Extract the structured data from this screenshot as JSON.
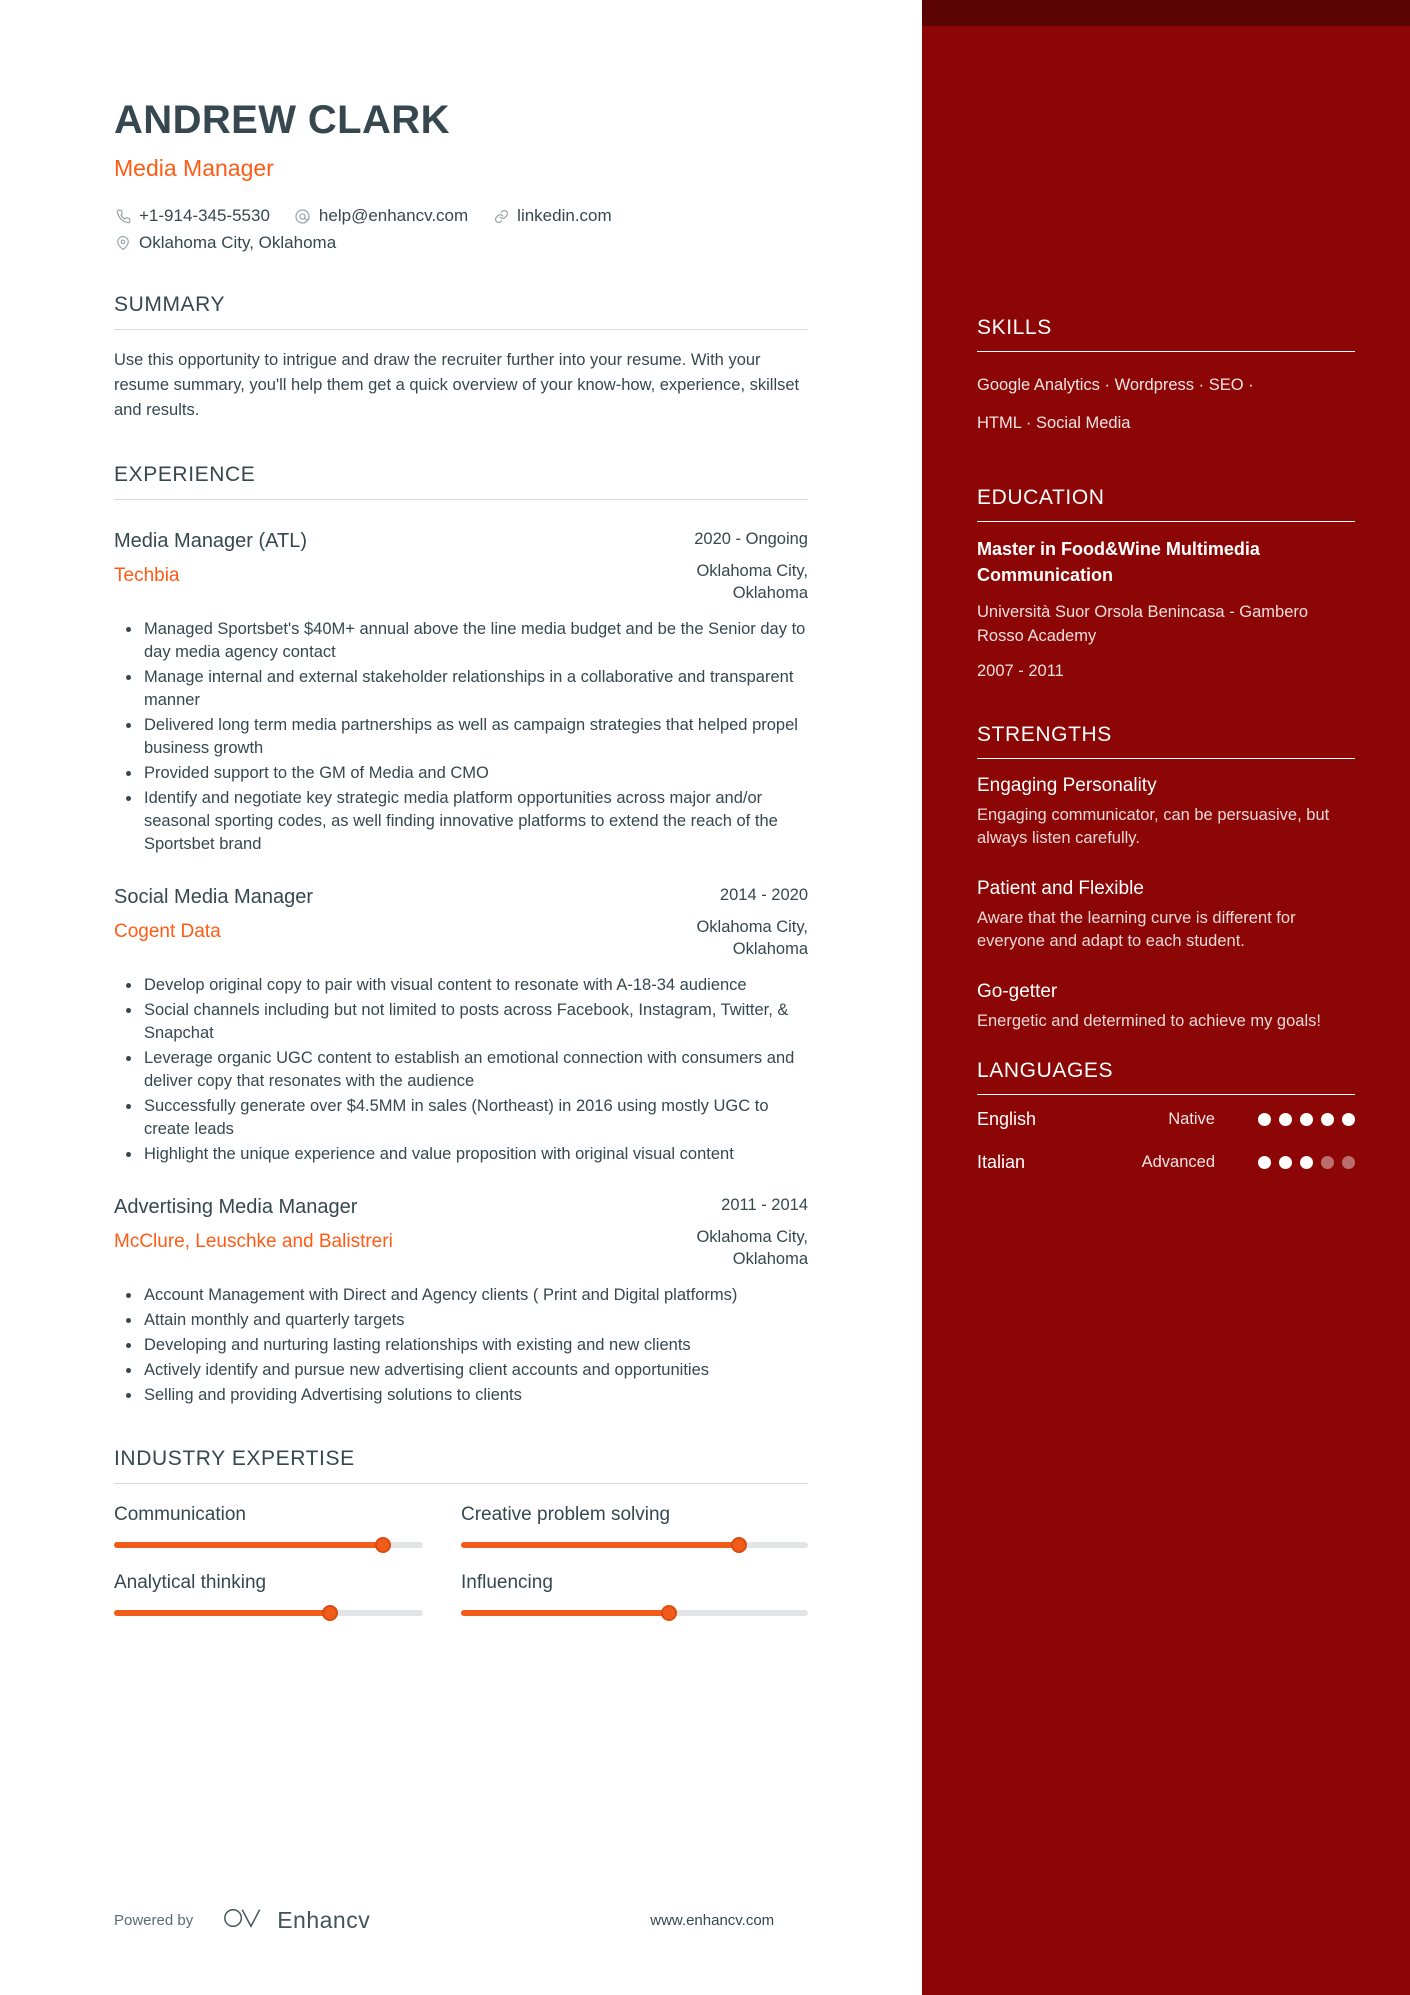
{
  "colors": {
    "accent": "#ff5b14",
    "sidebar_bg": "#8c0606",
    "sidebar_cap": "#5c0303",
    "text": "#37474f"
  },
  "header": {
    "name": "ANDREW CLARK",
    "title": "Media Manager",
    "contacts": [
      {
        "icon": "phone-icon",
        "value": "+1-914-345-5530"
      },
      {
        "icon": "email-icon",
        "value": "help@enhancv.com"
      },
      {
        "icon": "link-icon",
        "value": "linkedin.com"
      }
    ],
    "location": {
      "icon": "location-pin-icon",
      "value": "Oklahoma City, Oklahoma"
    }
  },
  "summary": {
    "heading": "SUMMARY",
    "text": "Use this opportunity to intrigue and draw the recruiter further into your resume. With your resume summary, you'll help them get a quick overview of your know-how, experience, skillset and results."
  },
  "experience": {
    "heading": "EXPERIENCE",
    "entries": [
      {
        "role": "Media Manager (ATL)",
        "company": "Techbia",
        "dates": "2020 - Ongoing",
        "location": "Oklahoma City, Oklahoma",
        "bullets": [
          "Managed Sportsbet's $40M+ annual above the line media budget and be the Senior day to day media agency contact",
          "Manage internal and external stakeholder relationships in a collaborative and transparent manner",
          "Delivered long term media partnerships as well as campaign strategies that helped propel business growth",
          "Provided support to the GM of Media and CMO",
          "Identify and negotiate key strategic media platform opportunities across major and/or seasonal sporting codes, as well finding innovative platforms to extend the reach of the Sportsbet brand"
        ]
      },
      {
        "role": "Social Media Manager",
        "company": "Cogent Data",
        "dates": "2014 - 2020",
        "location": "Oklahoma City, Oklahoma",
        "bullets": [
          "Develop original copy to pair with visual content to resonate with A-18-34 audience",
          "Social channels including but not limited to posts across Facebook, Instagram, Twitter, & Snapchat",
          "Leverage organic UGC content to establish an emotional connection with consumers and deliver copy that resonates with the audience",
          "Successfully generate over $4.5MM in sales (Northeast) in 2016 using mostly UGC to create leads",
          "Highlight the unique experience and value proposition with original visual content"
        ]
      },
      {
        "role": "Advertising Media Manager",
        "company": "McClure, Leuschke and Balistreri",
        "dates": "2011 - 2014",
        "location": "Oklahoma City, Oklahoma",
        "bullets": [
          "Account Management with Direct and Agency clients ( Print and Digital platforms)",
          "Attain monthly and quarterly targets",
          "Developing and nurturing lasting relationships with existing and new clients",
          "Actively identify and pursue new advertising client accounts and opportunities",
          "Selling and providing Advertising solutions to clients"
        ]
      }
    ]
  },
  "industry_expertise": {
    "heading": "INDUSTRY EXPERTISE",
    "items": [
      {
        "label": "Communication",
        "percent": 87
      },
      {
        "label": "Creative problem solving",
        "percent": 80
      },
      {
        "label": "Analytical thinking",
        "percent": 70
      },
      {
        "label": "Influencing",
        "percent": 60
      }
    ]
  },
  "sidebar": {
    "skills": {
      "heading": "SKILLS",
      "lines": [
        "Google Analytics · Wordpress · SEO ·",
        "HTML · Social Media"
      ]
    },
    "education": {
      "heading": "EDUCATION",
      "degree": "Master in Food&Wine Multimedia Communication",
      "school": "Università Suor Orsola Benincasa - Gambero Rosso Academy",
      "dates": "2007 - 2011"
    },
    "strengths": {
      "heading": "STRENGTHS",
      "items": [
        {
          "title": "Engaging Personality",
          "desc": "Engaging communicator, can be persuasive, but always listen carefully."
        },
        {
          "title": "Patient and Flexible",
          "desc": "Aware that the learning curve is different for everyone and adapt to each student."
        },
        {
          "title": "Go-getter",
          "desc": "Energetic and determined to achieve my goals!"
        }
      ]
    },
    "languages": {
      "heading": "LANGUAGES",
      "items": [
        {
          "name": "English",
          "level": "Native",
          "dots": 5,
          "total": 5
        },
        {
          "name": "Italian",
          "level": "Advanced",
          "dots": 3,
          "total": 5
        }
      ]
    }
  },
  "footer": {
    "powered_by": "Powered by",
    "brand": "Enhancv",
    "site": "www.enhancv.com"
  }
}
